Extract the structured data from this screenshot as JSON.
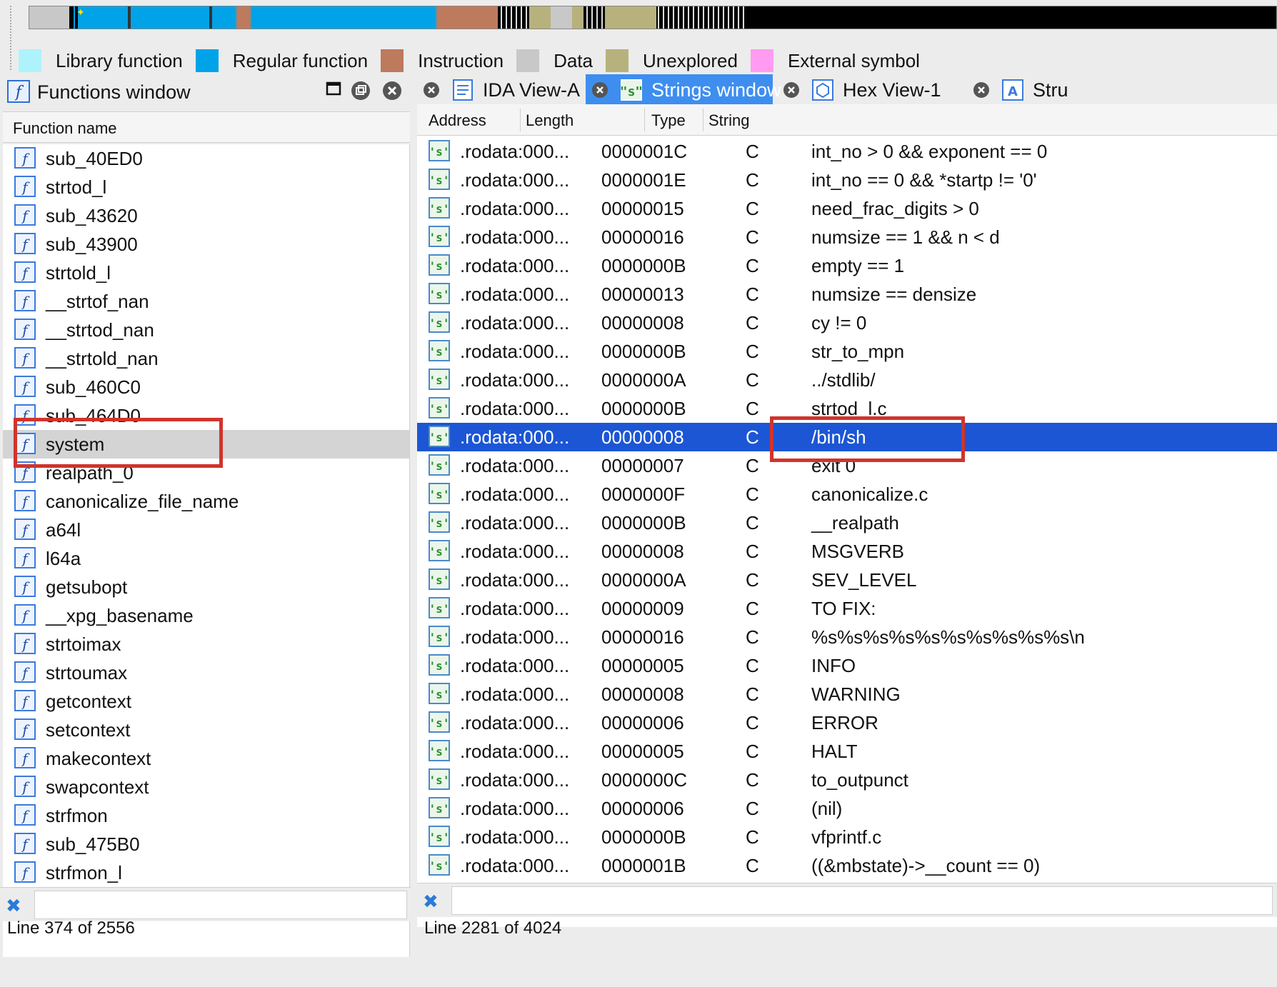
{
  "colors": {
    "library": "#aef3fb",
    "regular": "#00a3e8",
    "instruction": "#be7a5c",
    "data": "#c8c8c8",
    "unexplored": "#b7b27d",
    "external": "#ff9cf2",
    "selection": "#1c56d4",
    "highlight": "#d0342c"
  },
  "legend": [
    {
      "label": "Library function",
      "color": "#aef3fb"
    },
    {
      "label": "Regular function",
      "color": "#00a3e8"
    },
    {
      "label": "Instruction",
      "color": "#be7a5c"
    },
    {
      "label": "Data",
      "color": "#c8c8c8"
    },
    {
      "label": "Unexplored",
      "color": "#b7b27d"
    },
    {
      "label": "External symbol",
      "color": "#ff9cf2"
    }
  ],
  "functions_window": {
    "title": "Functions window",
    "column_header": "Function name",
    "selected": "system",
    "items": [
      "sub_40ED0",
      "strtod_l",
      "sub_43620",
      "sub_43900",
      "strtold_l",
      "__strtof_nan",
      "__strtod_nan",
      "__strtold_nan",
      "sub_460C0",
      "sub_464D0",
      "system",
      "realpath_0",
      "canonicalize_file_name",
      "a64l",
      "l64a",
      "getsubopt",
      "__xpg_basename",
      "strtoimax",
      "strtoumax",
      "getcontext",
      "setcontext",
      "makecontext",
      "swapcontext",
      "strfmon",
      "sub_475B0",
      "strfmon_l"
    ],
    "status": "Line 374 of 2556"
  },
  "tabs": [
    {
      "label": "IDA View-A",
      "icon": "ida-view-icon",
      "active": false
    },
    {
      "label": "Strings window",
      "icon": "strings-icon",
      "active": true
    },
    {
      "label": "Hex View-1",
      "icon": "hex-icon",
      "active": false
    },
    {
      "label": "Stru",
      "icon": "structures-icon",
      "active": false
    }
  ],
  "strings_window": {
    "columns": [
      "Address",
      "Length",
      "Type",
      "String"
    ],
    "selected_string": "/bin/sh",
    "rows": [
      [
        ".rodata:000...",
        "0000001C",
        "C",
        "int_no > 0 && exponent == 0"
      ],
      [
        ".rodata:000...",
        "0000001E",
        "C",
        "int_no == 0 && *startp != '0'"
      ],
      [
        ".rodata:000...",
        "00000015",
        "C",
        "need_frac_digits > 0"
      ],
      [
        ".rodata:000...",
        "00000016",
        "C",
        "numsize == 1 && n < d"
      ],
      [
        ".rodata:000...",
        "0000000B",
        "C",
        "empty == 1"
      ],
      [
        ".rodata:000...",
        "00000013",
        "C",
        "numsize == densize"
      ],
      [
        ".rodata:000...",
        "00000008",
        "C",
        "cy != 0"
      ],
      [
        ".rodata:000...",
        "0000000B",
        "C",
        "str_to_mpn"
      ],
      [
        ".rodata:000...",
        "0000000A",
        "C",
        "../stdlib/"
      ],
      [
        ".rodata:000...",
        "0000000B",
        "C",
        "strtod_l.c"
      ],
      [
        ".rodata:000...",
        "00000008",
        "C",
        "/bin/sh"
      ],
      [
        ".rodata:000...",
        "00000007",
        "C",
        "exit 0"
      ],
      [
        ".rodata:000...",
        "0000000F",
        "C",
        "canonicalize.c"
      ],
      [
        ".rodata:000...",
        "0000000B",
        "C",
        "__realpath"
      ],
      [
        ".rodata:000...",
        "00000008",
        "C",
        "MSGVERB"
      ],
      [
        ".rodata:000...",
        "0000000A",
        "C",
        "SEV_LEVEL"
      ],
      [
        ".rodata:000...",
        "00000009",
        "C",
        "TO FIX: "
      ],
      [
        ".rodata:000...",
        "00000016",
        "C",
        "%s%s%s%s%s%s%s%s%s%s\\n"
      ],
      [
        ".rodata:000...",
        "00000005",
        "C",
        "INFO"
      ],
      [
        ".rodata:000...",
        "00000008",
        "C",
        "WARNING"
      ],
      [
        ".rodata:000...",
        "00000006",
        "C",
        "ERROR"
      ],
      [
        ".rodata:000...",
        "00000005",
        "C",
        "HALT"
      ],
      [
        ".rodata:000...",
        "0000000C",
        "C",
        "to_outpunct"
      ],
      [
        ".rodata:000...",
        "00000006",
        "C",
        "(nil)"
      ],
      [
        ".rodata:000...",
        "0000000B",
        "C",
        "vfprintf.c"
      ],
      [
        ".rodata:000...",
        "0000001B",
        "C",
        "((&mbstate)->__count == 0)"
      ]
    ],
    "status": "Line 2281 of 4024"
  }
}
